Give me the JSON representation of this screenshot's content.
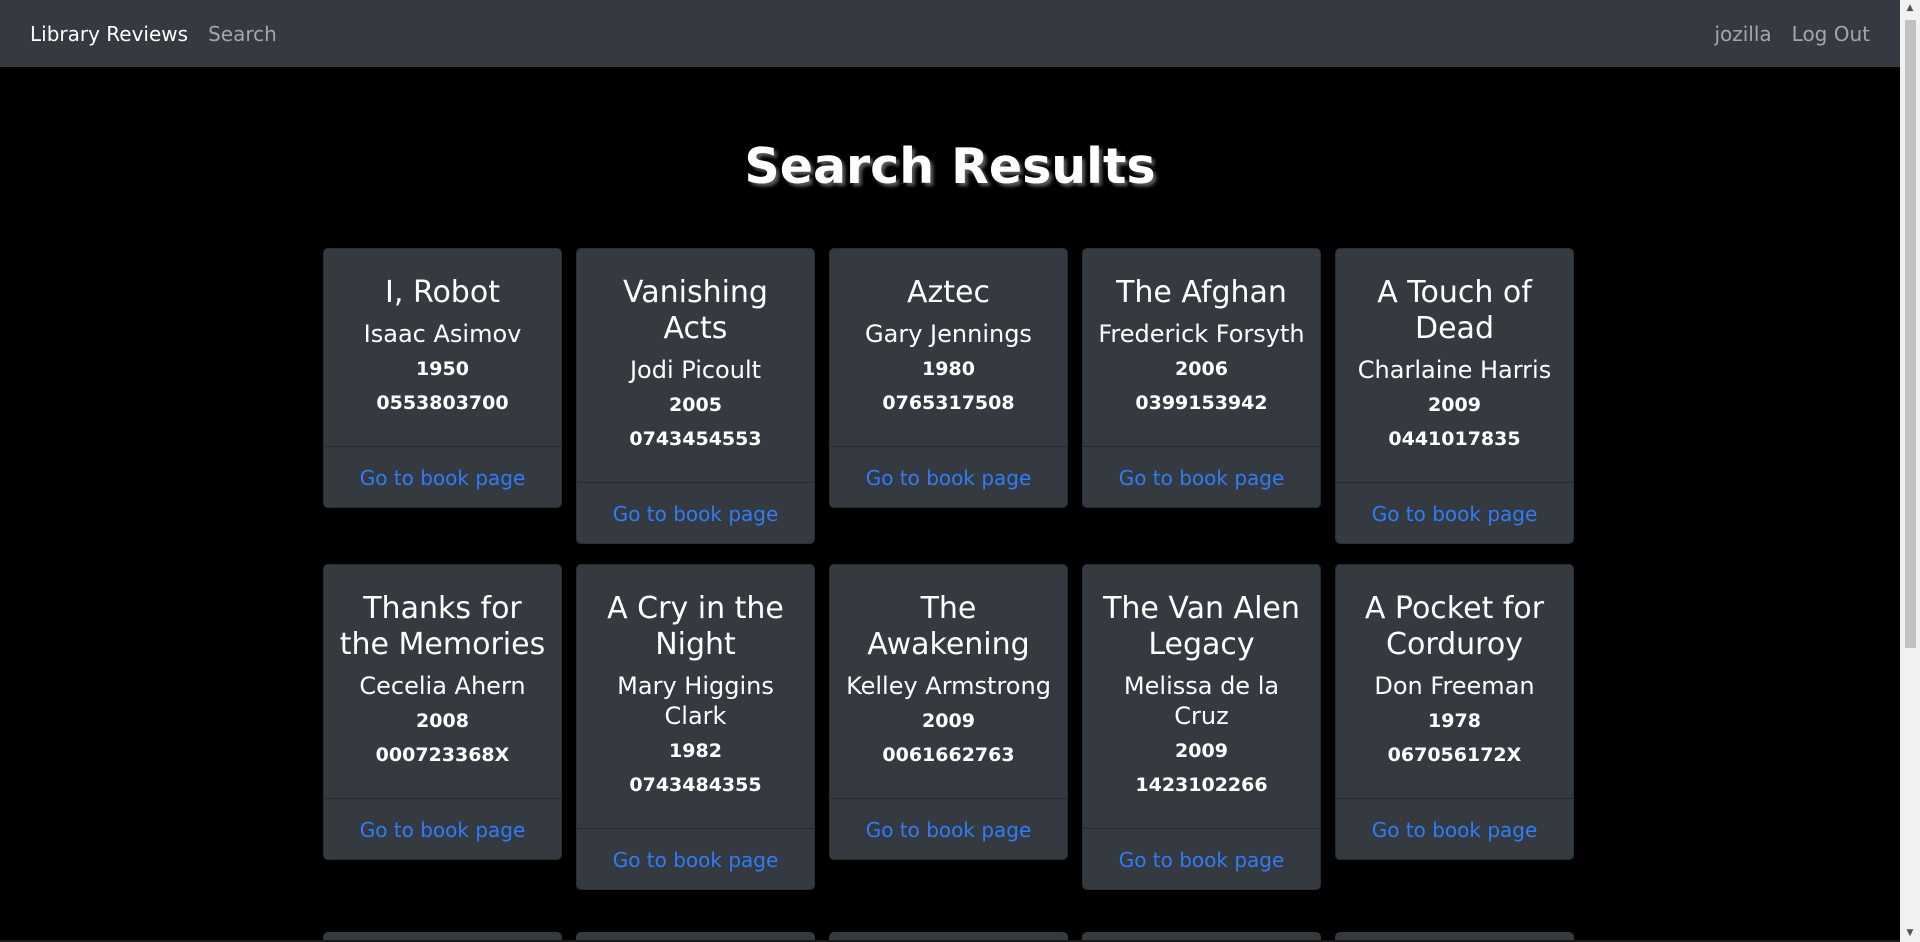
{
  "navbar": {
    "brand": "Library Reviews",
    "search_link": "Search",
    "username": "jozilla",
    "logout": "Log Out"
  },
  "main": {
    "title": "Search Results"
  },
  "books": [
    {
      "title": "I, Robot",
      "author": "Isaac Asimov",
      "year": "1950",
      "isbn": "0553803700",
      "link": "Go to book page"
    },
    {
      "title": "Vanishing Acts",
      "author": "Jodi Picoult",
      "year": "2005",
      "isbn": "0743454553",
      "link": "Go to book page"
    },
    {
      "title": "Aztec",
      "author": "Gary Jennings",
      "year": "1980",
      "isbn": "0765317508",
      "link": "Go to book page"
    },
    {
      "title": "The Afghan",
      "author": "Frederick Forsyth",
      "year": "2006",
      "isbn": "0399153942",
      "link": "Go to book page"
    },
    {
      "title": "A Touch of Dead",
      "author": "Charlaine Harris",
      "year": "2009",
      "isbn": "0441017835",
      "link": "Go to book page"
    },
    {
      "title": "Thanks for the Memories",
      "author": "Cecelia Ahern",
      "year": "2008",
      "isbn": "000723368X",
      "link": "Go to book page"
    },
    {
      "title": "A Cry in the Night",
      "author": "Mary Higgins Clark",
      "year": "1982",
      "isbn": "0743484355",
      "link": "Go to book page"
    },
    {
      "title": "The Awakening",
      "author": "Kelley Armstrong",
      "year": "2009",
      "isbn": "0061662763",
      "link": "Go to book page"
    },
    {
      "title": "The Van Alen Legacy",
      "author": "Melissa de la Cruz",
      "year": "2009",
      "isbn": "1423102266",
      "link": "Go to book page"
    },
    {
      "title": "A Pocket for Corduroy",
      "author": "Don Freeman",
      "year": "1978",
      "isbn": "067056172X",
      "link": "Go to book page"
    }
  ],
  "colors": {
    "navbar_bg": "#343a40",
    "page_bg": "#000000",
    "card_bg": "#343a40",
    "link": "#2f7cf6"
  }
}
